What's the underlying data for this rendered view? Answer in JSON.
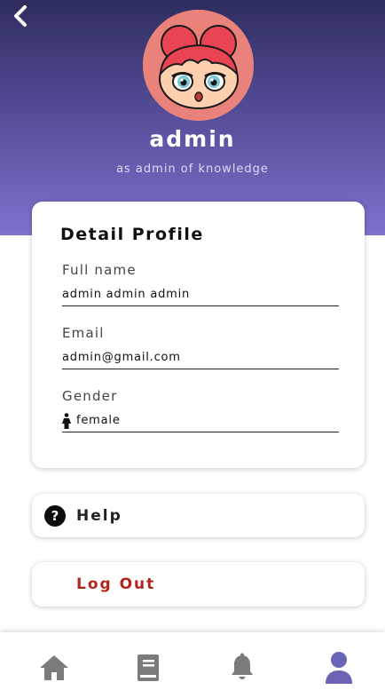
{
  "profile": {
    "name": "admin",
    "role": "as admin of knowledge"
  },
  "detail": {
    "title": "Detail Profile",
    "fullname_label": "Full name",
    "fullname_value": "admin admin admin",
    "email_label": "Email",
    "email_value": "admin@gmail.com",
    "gender_label": "Gender",
    "gender_value": "female"
  },
  "actions": {
    "help_label": "Help",
    "help_icon_glyph": "?",
    "logout_label": "Log Out"
  },
  "nav": {
    "items": [
      {
        "icon": "home-icon",
        "active": false
      },
      {
        "icon": "book-icon",
        "active": false
      },
      {
        "icon": "bell-icon",
        "active": false
      },
      {
        "icon": "user-icon",
        "active": true
      }
    ]
  },
  "colors": {
    "header_top": "#2e2d5e",
    "header_bottom": "#7d72cc",
    "avatar_bg": "#e8827a",
    "logout": "#b3261e",
    "nav_inactive": "#7b7b7b",
    "nav_active": "#6b63b5"
  }
}
